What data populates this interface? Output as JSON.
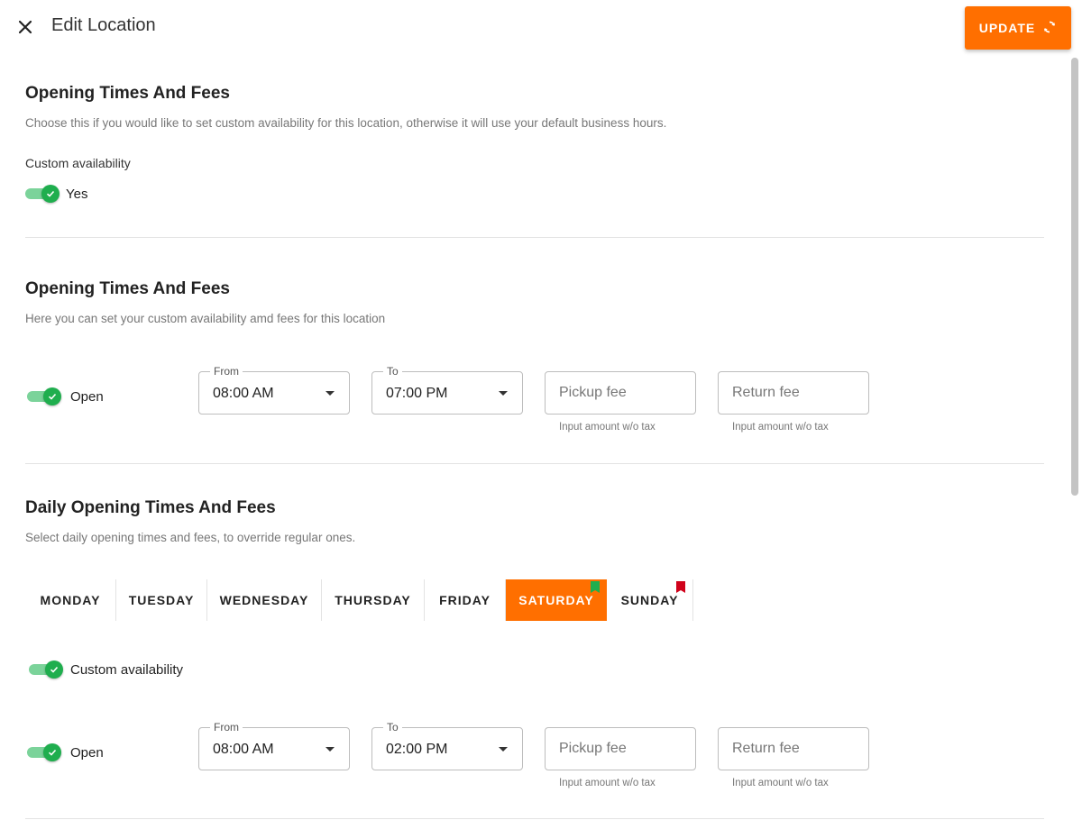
{
  "header": {
    "title": "Edit Location",
    "update_label": "UPDATE",
    "icons": {
      "close": "close-icon",
      "update": "sync-icon"
    }
  },
  "colors": {
    "accent": "#ff6f00",
    "toggle_on": "#1fae4e",
    "flag_green": "#1fae4e",
    "flag_red": "#d0021b"
  },
  "section1": {
    "title": "Opening Times And Fees",
    "description": "Choose this if you would like to set custom availability for this location, otherwise it will use your default business hours.",
    "custom_label": "Custom availability",
    "toggle_label": "Yes"
  },
  "section2": {
    "title": "Opening Times And Fees",
    "description": "Here you can set your custom availability amd fees for this location",
    "open_label": "Open",
    "from_legend": "From",
    "from_value": "08:00 AM",
    "to_legend": "To",
    "to_value": "07:00 PM",
    "pickup_placeholder": "Pickup fee",
    "return_placeholder": "Return fee",
    "helper": "Input amount w/o tax"
  },
  "section3": {
    "title": "Daily Opening Times And Fees",
    "description": "Select daily opening times and fees, to override regular ones.",
    "tabs": [
      {
        "label": "MONDAY",
        "flag": ""
      },
      {
        "label": "TUESDAY",
        "flag": ""
      },
      {
        "label": "WEDNESDAY",
        "flag": ""
      },
      {
        "label": "THURSDAY",
        "flag": ""
      },
      {
        "label": "FRIDAY",
        "flag": ""
      },
      {
        "label": "SATURDAY",
        "flag": "green",
        "active": true
      },
      {
        "label": "SUNDAY",
        "flag": "red"
      }
    ],
    "custom_toggle_label": "Custom availability",
    "open_label": "Open",
    "from_legend": "From",
    "from_value": "08:00 AM",
    "to_legend": "To",
    "to_value": "02:00 PM",
    "pickup_placeholder": "Pickup fee",
    "return_placeholder": "Return fee",
    "helper": "Input amount w/o tax"
  }
}
